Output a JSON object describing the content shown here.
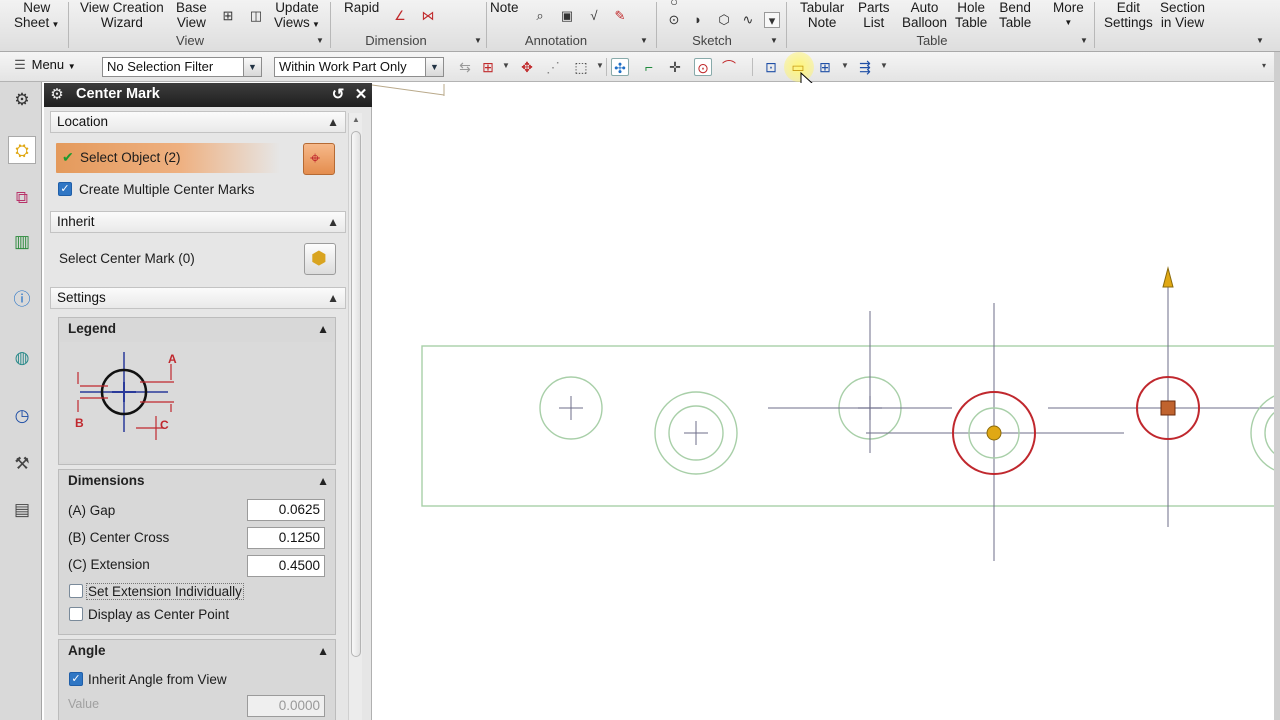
{
  "ribbon": {
    "buttons": [
      {
        "id": "new_sheet",
        "line1": "New",
        "line2": "Sheet",
        "has_arrow": true
      },
      {
        "id": "view_wizard",
        "line1": "View Creation",
        "line2": "Wizard"
      },
      {
        "id": "base_view",
        "line1": "Base",
        "line2": "View"
      },
      {
        "id": "update_views",
        "line1": "Update",
        "line2": "Views",
        "has_arrow": true
      },
      {
        "id": "rapid",
        "line1": "Rapid",
        "line2": ""
      },
      {
        "id": "note",
        "line1": "Note",
        "line2": ""
      },
      {
        "id": "tabular_note",
        "line1": "Tabular",
        "line2": "Note"
      },
      {
        "id": "parts_list",
        "line1": "Parts",
        "line2": "List"
      },
      {
        "id": "auto_balloon",
        "line1": "Auto",
        "line2": "Balloon"
      },
      {
        "id": "hole_table",
        "line1": "Hole",
        "line2": "Table"
      },
      {
        "id": "bend_table",
        "line1": "Bend",
        "line2": "Table"
      },
      {
        "id": "more",
        "line1": "More",
        "line2": "",
        "has_arrow": true
      },
      {
        "id": "edit_settings",
        "line1": "Edit",
        "line2": "Settings"
      },
      {
        "id": "section_in_view",
        "line1": "Section",
        "line2": "in View"
      }
    ],
    "groups": {
      "view": "View",
      "dimension": "Dimension",
      "annotation": "Annotation",
      "sketch": "Sketch",
      "table": "Table"
    }
  },
  "toolbar": {
    "menu_label": "Menu",
    "selection_filter": "No Selection Filter",
    "scope_filter": "Within Work Part Only"
  },
  "dialog": {
    "title": "Center Mark",
    "sections": {
      "location": "Location",
      "inherit": "Inherit",
      "settings": "Settings"
    },
    "select_object": "Select Object (2)",
    "create_multiple": "Create Multiple Center Marks",
    "create_multiple_checked": true,
    "select_center_mark": "Select Center Mark (0)",
    "legend": {
      "title": "Legend",
      "label_a": "A",
      "label_b": "B",
      "label_c": "C"
    },
    "dimensions": {
      "title": "Dimensions",
      "gap_label": "(A) Gap",
      "gap_value": "0.0625",
      "cross_label": "(B) Center Cross",
      "cross_value": "0.1250",
      "ext_label": "(C) Extension",
      "ext_value": "0.4500",
      "set_ext_individually": "Set Extension Individually",
      "display_center_point": "Display as Center Point"
    },
    "angle": {
      "title": "Angle",
      "inherit_angle": "Inherit Angle from View",
      "inherit_checked": true,
      "value_label": "Value",
      "value": "0.0000"
    }
  },
  "colors": {
    "accent_orange": "#e8955a",
    "sketch_green": "#a8cfa8",
    "selected_red": "#c0282e",
    "centerline": "#6e6e8a",
    "handle_yellow": "#e0a814",
    "highlight_yellow": "#fff23a"
  }
}
